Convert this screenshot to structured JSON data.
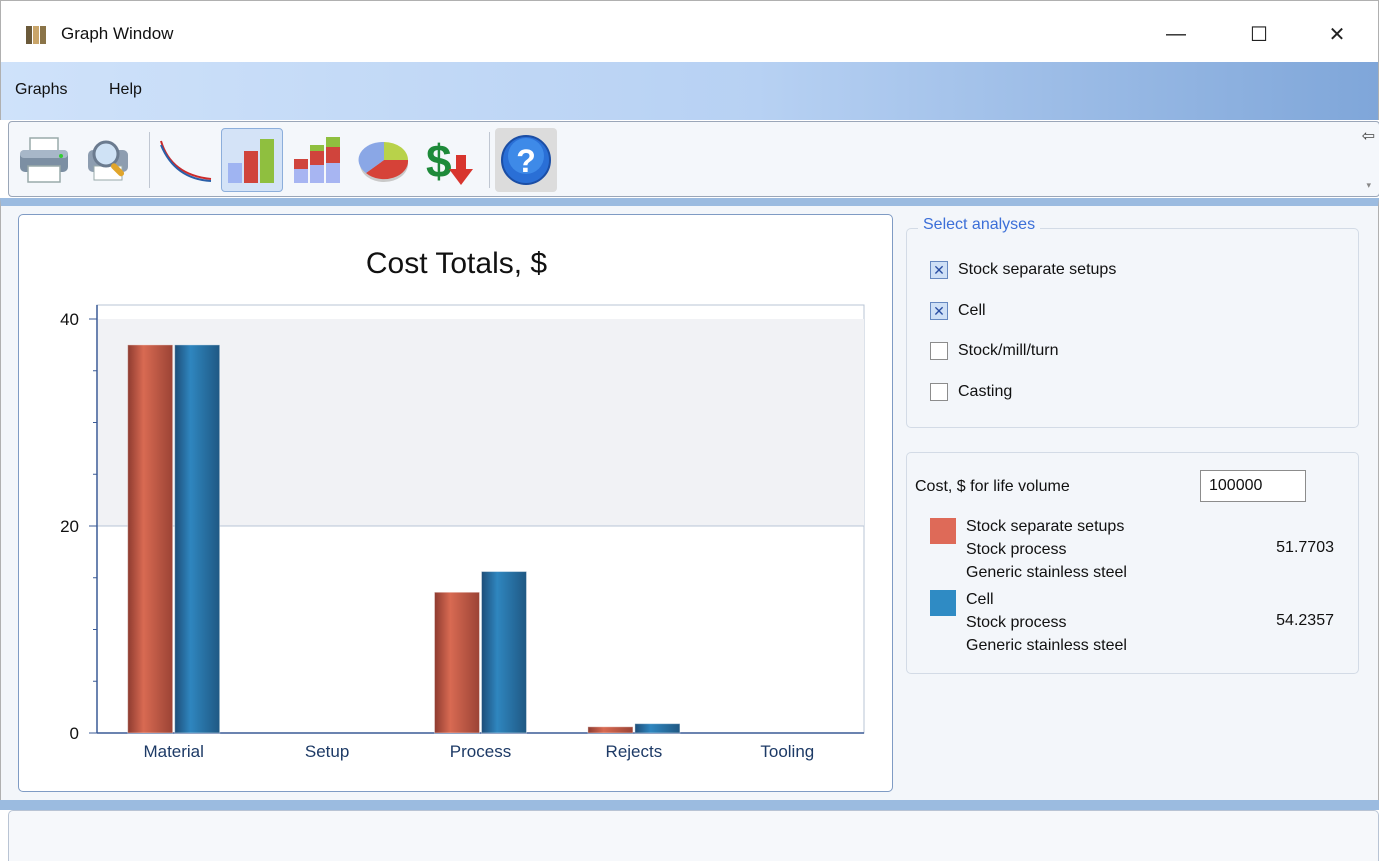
{
  "window": {
    "title": "Graph Window",
    "minimize_glyph": "—",
    "maximize_glyph": "☐",
    "close_glyph": "✕"
  },
  "menu": {
    "items": [
      {
        "label": "Graphs"
      },
      {
        "label": "Help"
      }
    ]
  },
  "toolbar": {
    "buttons": [
      {
        "icon": "printer-icon"
      },
      {
        "icon": "print-preview-icon"
      },
      {
        "icon": "curve-graph-icon"
      },
      {
        "icon": "bar-graph-icon",
        "active": true
      },
      {
        "icon": "stacked-bar-graph-icon"
      },
      {
        "icon": "pie-chart-icon"
      },
      {
        "icon": "cost-dollar-down-icon"
      },
      {
        "icon": "help-icon",
        "active": true
      }
    ],
    "pin_glyph": "⇦",
    "overflow_glyph": "▾"
  },
  "chart_data": {
    "type": "bar",
    "title": "Cost Totals, $",
    "categories": [
      "Material",
      "Setup",
      "Process",
      "Rejects",
      "Tooling"
    ],
    "series": [
      {
        "color": "#d86a52",
        "values": [
          37.5,
          0,
          13.6,
          0.6,
          0
        ]
      },
      {
        "color": "#2f86bf",
        "values": [
          37.5,
          0,
          15.6,
          0.9,
          0
        ]
      }
    ],
    "ylim": [
      0,
      40
    ],
    "yticks": [
      "0",
      "20",
      "40"
    ],
    "shaded_band": [
      20,
      40
    ]
  },
  "analyses": {
    "group_label": "Select analyses",
    "options": [
      {
        "label": "Stock separate setups",
        "checked": true
      },
      {
        "label": "Cell",
        "checked": true
      },
      {
        "label": "Stock/mill/turn",
        "checked": false
      },
      {
        "label": "Casting",
        "checked": false
      }
    ],
    "check_glyph": "✕"
  },
  "cost": {
    "label": "Cost, $ for life volume",
    "volume": "100000",
    "legend": [
      {
        "color": "#de6a58",
        "lines": [
          "Stock separate setups",
          "Stock process",
          "Generic stainless steel"
        ],
        "value": "51.7703"
      },
      {
        "color": "#2f8bc4",
        "lines": [
          "Cell",
          "Stock process",
          "Generic stainless steel"
        ],
        "value": "54.2357"
      }
    ]
  }
}
